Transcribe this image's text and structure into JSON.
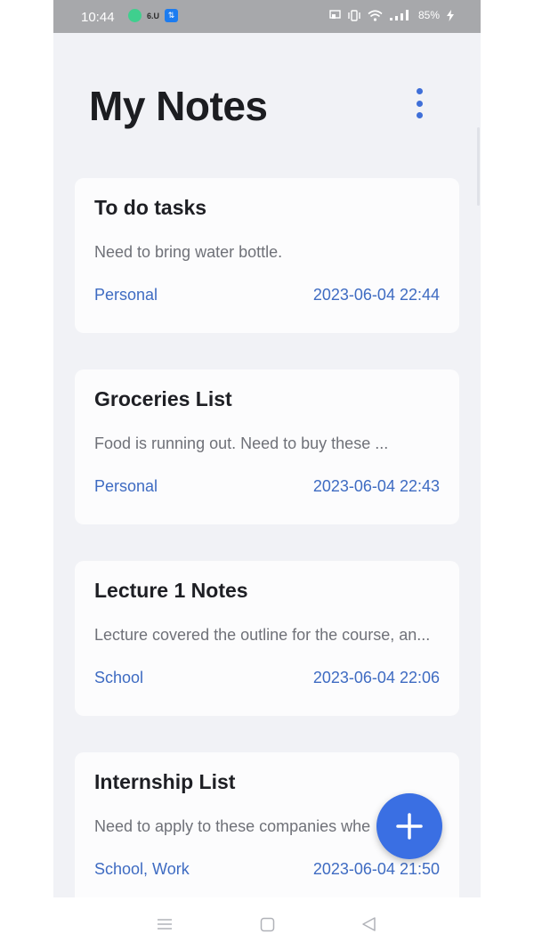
{
  "status_bar": {
    "time": "10:44",
    "left_icons": [
      "app-circle-icon",
      "carrier-logo-icon",
      "usb-icon"
    ],
    "carrier_text": "6.U",
    "battery": "85%",
    "right_icons": [
      "cast-icon",
      "vibrate-icon",
      "wifi-icon",
      "signal-icon",
      "charging-icon"
    ]
  },
  "header": {
    "title": "My Notes",
    "menu_icon": "more-vertical-icon"
  },
  "notes": [
    {
      "title": "To do tasks",
      "preview": "Need to bring water bottle.",
      "tags": "Personal",
      "date": "2023-06-04 22:44"
    },
    {
      "title": "Groceries List",
      "preview": "Food is running out. Need to buy these ...",
      "tags": "Personal",
      "date": "2023-06-04 22:43"
    },
    {
      "title": "Lecture 1 Notes",
      "preview": "Lecture covered the outline for the course, an...",
      "tags": "School",
      "date": "2023-06-04 22:06"
    },
    {
      "title": "Internship List",
      "preview": "Need to apply to these companies whe",
      "tags": "School, Work",
      "date": "2023-06-04 21:50"
    }
  ],
  "fab": {
    "icon": "plus-icon"
  },
  "nav_bar": {
    "icons": [
      "menu-lines-icon",
      "home-square-icon",
      "back-triangle-icon"
    ]
  },
  "colors": {
    "accent": "#3a6fe3",
    "tag_text": "#3e6bc2",
    "background": "#f1f2f6",
    "card": "#fcfcfd"
  }
}
